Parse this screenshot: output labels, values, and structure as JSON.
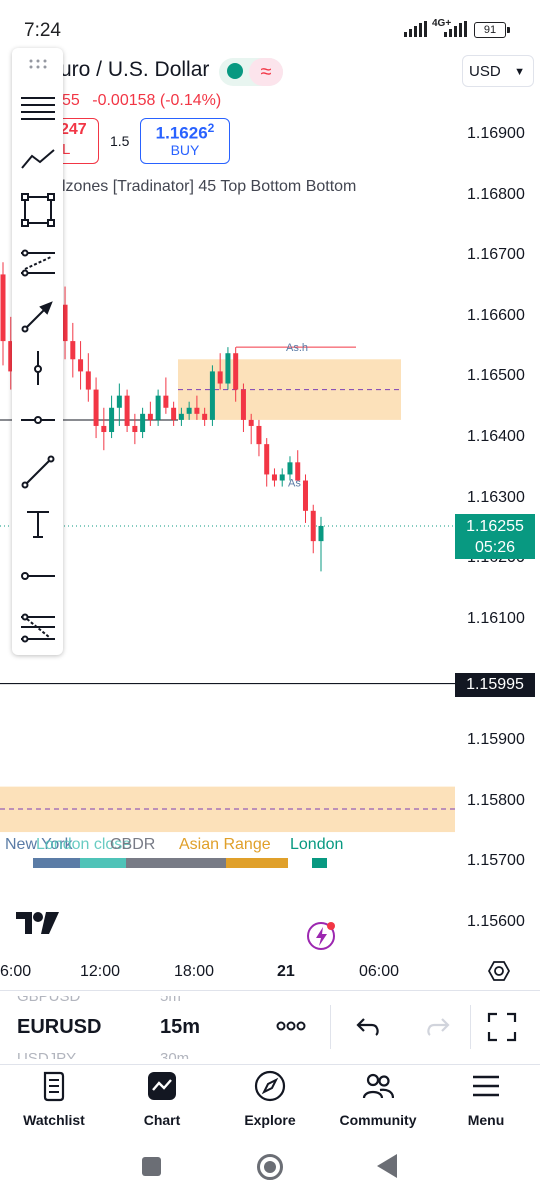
{
  "status_bar": {
    "time": "7:24",
    "network": "4G+",
    "battery": "91"
  },
  "header": {
    "symbol_title": "uro / U.S. Dollar",
    "price_partial": "55",
    "change": "-0.00158 (-0.14%)",
    "sell_price": "247",
    "sell_label": "L",
    "spread": "1.5",
    "buy_price_main": "1.1626",
    "buy_price_sup": "2",
    "buy_label": "BUY",
    "indicator": "lzones [Tradinator] 45 Top Bottom Bottom",
    "currency": "USD"
  },
  "chart_data": {
    "type": "candlestick",
    "symbol": "EURUSD",
    "interval": "15m",
    "price_axis_ticks": [
      "1.16900",
      "1.16800",
      "1.16700",
      "1.16600",
      "1.16500",
      "1.16400",
      "1.16300",
      "1.16200",
      "1.16100",
      "1.15900",
      "1.15800",
      "1.15700",
      "1.15600"
    ],
    "time_axis_ticks": [
      "6:00",
      "12:00",
      "18:00",
      "21",
      "06:00"
    ],
    "last_price": "1.16255",
    "countdown": "05:26",
    "horizontal_line_price": "1.15995",
    "annotations": [
      "As.h",
      "As"
    ],
    "zones": [
      {
        "top": 1.1653,
        "bottom": 1.1643,
        "mid": 1.1648,
        "color": "#fcdcae"
      },
      {
        "top": 1.15825,
        "bottom": 1.1575,
        "mid": 1.15788,
        "color": "#fcdcae"
      }
    ],
    "ohlc": [
      [
        1.1667,
        1.1669,
        1.1652,
        1.1656
      ],
      [
        1.1656,
        1.166,
        1.1648,
        1.1651
      ],
      [
        1.1651,
        1.1654,
        1.1643,
        1.1646
      ],
      [
        1.1646,
        1.1652,
        1.1644,
        1.165
      ],
      [
        1.165,
        1.1656,
        1.1647,
        1.1654
      ],
      [
        1.1654,
        1.1662,
        1.1652,
        1.166
      ],
      [
        1.166,
        1.1665,
        1.1656,
        1.1658
      ],
      [
        1.1658,
        1.1664,
        1.1654,
        1.1662
      ],
      [
        1.1662,
        1.1665,
        1.1653,
        1.1656
      ],
      [
        1.1656,
        1.1659,
        1.165,
        1.1653
      ],
      [
        1.1653,
        1.1656,
        1.1648,
        1.1651
      ],
      [
        1.1651,
        1.1654,
        1.1646,
        1.1648
      ],
      [
        1.1648,
        1.165,
        1.164,
        1.1642
      ],
      [
        1.1642,
        1.1645,
        1.1638,
        1.1641
      ],
      [
        1.1641,
        1.1647,
        1.164,
        1.1645
      ],
      [
        1.1645,
        1.1649,
        1.1642,
        1.1647
      ],
      [
        1.1647,
        1.1648,
        1.1641,
        1.1642
      ],
      [
        1.1642,
        1.1644,
        1.1639,
        1.1641
      ],
      [
        1.1641,
        1.1645,
        1.164,
        1.1644
      ],
      [
        1.1644,
        1.1646,
        1.1642,
        1.1643
      ],
      [
        1.1643,
        1.1648,
        1.1642,
        1.1647
      ],
      [
        1.1647,
        1.165,
        1.1644,
        1.1645
      ],
      [
        1.1645,
        1.1646,
        1.1642,
        1.1643
      ],
      [
        1.1643,
        1.1645,
        1.1642,
        1.1644
      ],
      [
        1.1644,
        1.1646,
        1.1643,
        1.1645
      ],
      [
        1.1645,
        1.1647,
        1.1643,
        1.1644
      ],
      [
        1.1644,
        1.1645,
        1.1642,
        1.1643
      ],
      [
        1.1643,
        1.1652,
        1.1642,
        1.1651
      ],
      [
        1.1651,
        1.1654,
        1.1648,
        1.1649
      ],
      [
        1.1649,
        1.1655,
        1.1648,
        1.1654
      ],
      [
        1.1654,
        1.1655,
        1.1646,
        1.1648
      ],
      [
        1.1648,
        1.1649,
        1.1641,
        1.1643
      ],
      [
        1.1643,
        1.1644,
        1.1639,
        1.1642
      ],
      [
        1.1642,
        1.1643,
        1.1637,
        1.1639
      ],
      [
        1.1639,
        1.164,
        1.1632,
        1.1634
      ],
      [
        1.1634,
        1.1635,
        1.1632,
        1.1633
      ],
      [
        1.1633,
        1.1635,
        1.1632,
        1.1634
      ],
      [
        1.1634,
        1.1637,
        1.1633,
        1.1636
      ],
      [
        1.1636,
        1.1638,
        1.1633,
        1.1633
      ],
      [
        1.1633,
        1.1634,
        1.1626,
        1.1628
      ],
      [
        1.1628,
        1.1629,
        1.1621,
        1.1623
      ],
      [
        1.1623,
        1.1627,
        1.1618,
        1.16255
      ]
    ]
  },
  "sessions": [
    {
      "name": "New York",
      "color": "#5b7ca6"
    },
    {
      "name": "London close",
      "color": "#4fc3b8"
    },
    {
      "name": "CBDR",
      "color": "#787b86"
    },
    {
      "name": "Asian Range",
      "color": "#e0a02a"
    },
    {
      "name": "London",
      "color": "#089981"
    }
  ],
  "bottom_toolbar": {
    "symbol_prev": "GBPUSD",
    "symbol_current": "EURUSD",
    "symbol_next": "USDJPY",
    "interval_prev": "5m",
    "interval_current": "15m",
    "interval_next": "30m"
  },
  "nav": {
    "watchlist": "Watchlist",
    "chart": "Chart",
    "explore": "Explore",
    "community": "Community",
    "menu": "Menu"
  }
}
